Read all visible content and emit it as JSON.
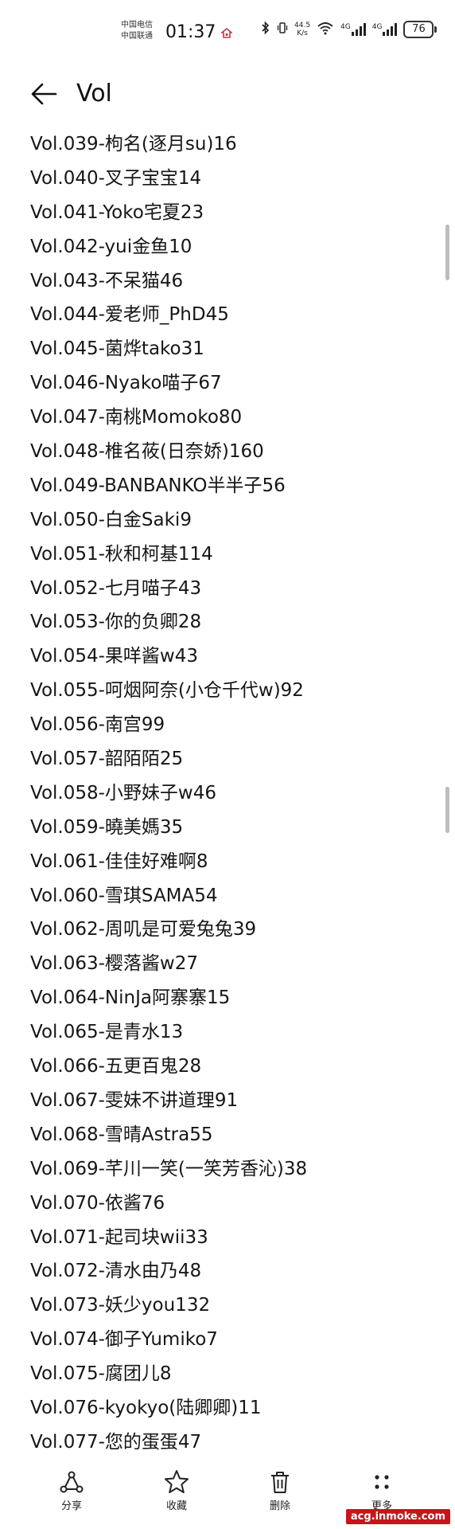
{
  "status_bar": {
    "carrier_1": "中国电信",
    "carrier_2": "中国联通",
    "time": "01:37",
    "net_speed_value": "44.5",
    "net_speed_unit": "K/s",
    "signal_label_1": "4G",
    "signal_label_2": "4G",
    "battery": "76"
  },
  "header": {
    "title": "Vol"
  },
  "items": [
    "Vol.039-枸名(逐月su)16",
    "Vol.040-叉子宝宝14",
    "Vol.041-Yoko宅夏23",
    "Vol.042-yui金鱼10",
    "Vol.043-不呆猫46",
    "Vol.044-爱老师_PhD45",
    "Vol.045-菌烨tako31",
    "Vol.046-Nyako喵子67",
    "Vol.047-南桃Momoko80",
    "Vol.048-椎名莜(日奈娇)160",
    "Vol.049-BANBANKO半半子56",
    "Vol.050-白金Saki9",
    "Vol.051-秋和柯基114",
    "Vol.052-七月喵子43",
    "Vol.053-你的负卿28",
    "Vol.054-果咩酱w43",
    "Vol.055-呵烟阿奈(小仓千代w)92",
    "Vol.056-南宫99",
    "Vol.057-韶陌陌25",
    "Vol.058-小野妹子w46",
    "Vol.059-曉美媽35",
    "Vol.061-佳佳好难啊8",
    "Vol.060-雪琪SAMA54",
    "Vol.062-周叽是可爱兔兔39",
    "Vol.063-樱落酱w27",
    "Vol.064-NinJa阿寨寨15",
    "Vol.065-是青水13",
    "Vol.066-五更百鬼28",
    "Vol.067-雯妹不讲道理91",
    "Vol.068-雪晴Astra55",
    "Vol.069-芊川一笑(一笑芳香沁)38",
    "Vol.070-依酱76",
    "Vol.071-起司块wii33",
    "Vol.072-清水由乃48",
    "Vol.073-妖少you132",
    "Vol.074-御子Yumiko7",
    "Vol.075-腐团儿8",
    "Vol.076-kyokyo(陆卿卿)11",
    "Vol.077-您的蛋蛋47"
  ],
  "bottom_bar": {
    "share": "分享",
    "favorite": "收藏",
    "delete": "删除",
    "more": "更多"
  },
  "watermark": "acg.inmoke.com",
  "colors": {
    "text": "#161616",
    "background": "#ffffff",
    "watermark_bg": "#c7151c",
    "scrollbar": "#bdbdbd"
  }
}
